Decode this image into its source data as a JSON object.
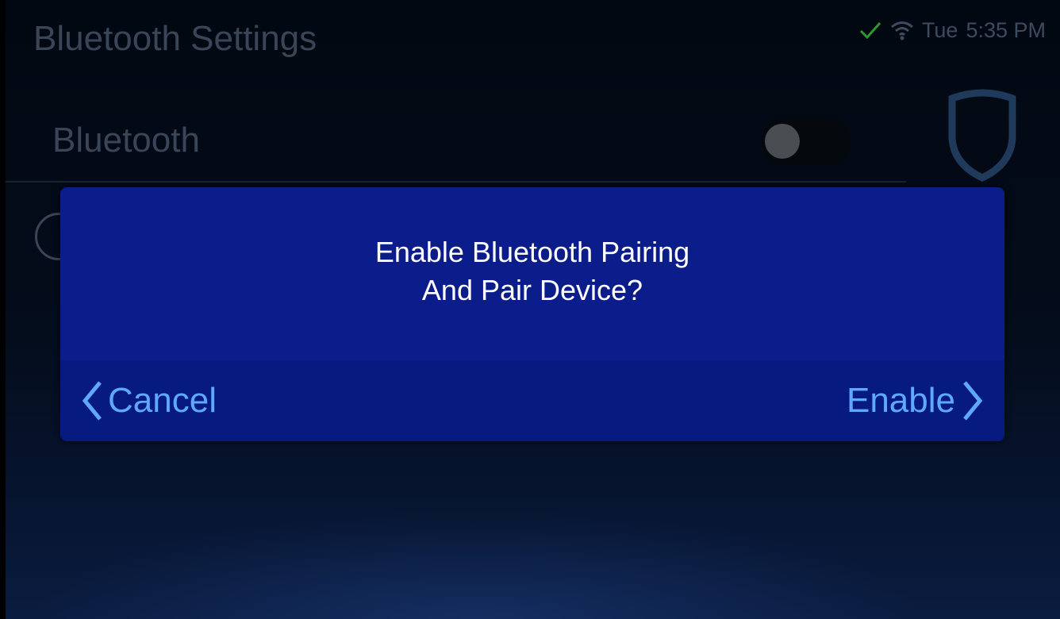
{
  "header": {
    "title": "Bluetooth Settings"
  },
  "status_bar": {
    "day": "Tue",
    "time": "5:35 PM",
    "check_icon": "check-icon",
    "wifi_icon": "wifi-icon",
    "check_color": "#2e9a2e"
  },
  "settings": {
    "bluetooth_label": "Bluetooth",
    "bluetooth_enabled": false
  },
  "dialog": {
    "line1": "Enable Bluetooth Pairing",
    "line2": "And Pair Device?",
    "cancel_label": "Cancel",
    "enable_label": "Enable",
    "background_color": "#0b1c8b",
    "button_color": "#5ea8ff"
  }
}
